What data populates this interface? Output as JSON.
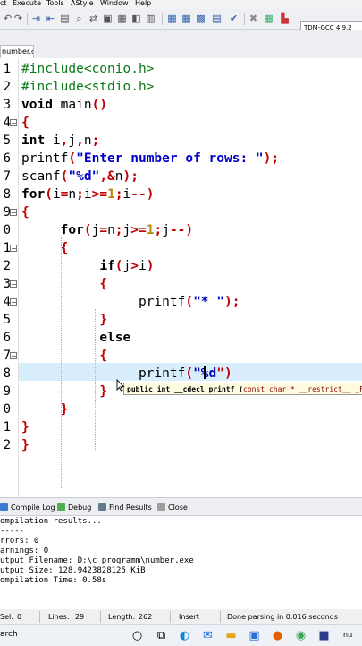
{
  "menu": [
    "ct",
    "Execute",
    "Tools",
    "AStyle",
    "Window",
    "Help"
  ],
  "toolbar": {
    "compiler": "TDM-GCC 4.9.2",
    "icons": [
      "undo-icon",
      "redo-icon",
      "indent-icon",
      "unindent-icon",
      "toggle-comment-icon",
      "search-icon",
      "replace-icon",
      "bookmark-icon",
      "compile-icon",
      "run-icon",
      "compile-run-icon",
      "rebuild-icon",
      "check-icon",
      "stop-icon",
      "debug-icon",
      "profile-icon"
    ]
  },
  "file_tab": "number.c",
  "editor": {
    "gutter_numbers": [
      "1",
      "2",
      "3",
      "4",
      "5",
      "6",
      "7",
      "8",
      "9",
      "0",
      "1",
      "2",
      "3",
      "4",
      "5",
      "6",
      "7",
      "8",
      "9",
      "0",
      "1",
      "2"
    ],
    "fold_lines": [
      3,
      8,
      10,
      12,
      13,
      16
    ],
    "current_line": 17,
    "code_lines": [
      [
        {
          "t": "#include<conio.h>",
          "c": "pp"
        }
      ],
      [
        {
          "t": "#include<stdio.h>",
          "c": "pp"
        }
      ],
      [
        {
          "t": "void",
          "c": "kw"
        },
        {
          "t": " main",
          "c": "fn"
        },
        {
          "t": "()",
          "c": "op"
        }
      ],
      [
        {
          "t": "{",
          "c": "op"
        }
      ],
      [
        {
          "t": "int",
          "c": "kw"
        },
        {
          "t": " i",
          "c": "fn"
        },
        {
          "t": ",",
          "c": "op"
        },
        {
          "t": "j",
          "c": "fn"
        },
        {
          "t": ",",
          "c": "op"
        },
        {
          "t": "n",
          "c": "fn"
        },
        {
          "t": ";",
          "c": "op"
        }
      ],
      [
        {
          "t": "printf",
          "c": "fn"
        },
        {
          "t": "(",
          "c": "op"
        },
        {
          "t": "\"Enter number of rows: \"",
          "c": "str"
        },
        {
          "t": ");",
          "c": "op"
        }
      ],
      [
        {
          "t": "scanf",
          "c": "fn"
        },
        {
          "t": "(",
          "c": "op"
        },
        {
          "t": "\"%d\"",
          "c": "str"
        },
        {
          "t": ",&",
          "c": "op"
        },
        {
          "t": "n",
          "c": "fn"
        },
        {
          "t": ");",
          "c": "op"
        }
      ],
      [
        {
          "t": "for",
          "c": "kw"
        },
        {
          "t": "(",
          "c": "op"
        },
        {
          "t": "i",
          "c": "fn"
        },
        {
          "t": "=",
          "c": "op"
        },
        {
          "t": "n",
          "c": "fn"
        },
        {
          "t": ";",
          "c": "op"
        },
        {
          "t": "i",
          "c": "fn"
        },
        {
          "t": ">=",
          "c": "op"
        },
        {
          "t": "1",
          "c": "num"
        },
        {
          "t": ";",
          "c": "op"
        },
        {
          "t": "i",
          "c": "fn"
        },
        {
          "t": "--)",
          "c": "op"
        }
      ],
      [
        {
          "t": "{",
          "c": "op"
        }
      ],
      [
        {
          "t": "     ",
          "c": "fn"
        },
        {
          "t": "for",
          "c": "kw"
        },
        {
          "t": "(",
          "c": "op"
        },
        {
          "t": "j",
          "c": "fn"
        },
        {
          "t": "=",
          "c": "op"
        },
        {
          "t": "n",
          "c": "fn"
        },
        {
          "t": ";",
          "c": "op"
        },
        {
          "t": "j",
          "c": "fn"
        },
        {
          "t": ">=",
          "c": "op"
        },
        {
          "t": "1",
          "c": "num"
        },
        {
          "t": ";",
          "c": "op"
        },
        {
          "t": "j",
          "c": "fn"
        },
        {
          "t": "--)",
          "c": "op"
        }
      ],
      [
        {
          "t": "     ",
          "c": "fn"
        },
        {
          "t": "{",
          "c": "op"
        }
      ],
      [
        {
          "t": "          ",
          "c": "fn"
        },
        {
          "t": "if",
          "c": "kw"
        },
        {
          "t": "(",
          "c": "op"
        },
        {
          "t": "j",
          "c": "fn"
        },
        {
          "t": ">",
          "c": "op"
        },
        {
          "t": "i",
          "c": "fn"
        },
        {
          "t": ")",
          "c": "op"
        }
      ],
      [
        {
          "t": "          ",
          "c": "fn"
        },
        {
          "t": "{",
          "c": "op"
        }
      ],
      [
        {
          "t": "               ",
          "c": "fn"
        },
        {
          "t": "printf",
          "c": "fn"
        },
        {
          "t": "(",
          "c": "op"
        },
        {
          "t": "\"* \"",
          "c": "str"
        },
        {
          "t": ");",
          "c": "op"
        }
      ],
      [
        {
          "t": "          ",
          "c": "fn"
        },
        {
          "t": "}",
          "c": "op"
        }
      ],
      [
        {
          "t": "          ",
          "c": "fn"
        },
        {
          "t": "else",
          "c": "kw"
        }
      ],
      [
        {
          "t": "          ",
          "c": "fn"
        },
        {
          "t": "{",
          "c": "op"
        }
      ],
      [
        {
          "t": "               ",
          "c": "fn"
        },
        {
          "t": "printf",
          "c": "fn"
        },
        {
          "t": "(",
          "c": "op"
        },
        {
          "t": "\"%d",
          "c": "str"
        },
        {
          "t": "\")",
          "c": "op"
        }
      ],
      [
        {
          "t": "          ",
          "c": "fn"
        },
        {
          "t": "}",
          "c": "op"
        }
      ],
      [
        {
          "t": "     ",
          "c": "fn"
        },
        {
          "t": "}",
          "c": "op"
        }
      ],
      [
        {
          "t": "}",
          "c": "op"
        }
      ],
      [
        {
          "t": "}",
          "c": "op"
        }
      ]
    ],
    "tooltip": {
      "prefix": "public int __cdecl printf (",
      "params": "const char * __restrict__ _F"
    }
  },
  "bottom_tabs": [
    {
      "label": "Compile Log",
      "color": "#3a7bd5"
    },
    {
      "label": "Debug",
      "color": "#4caf50"
    },
    {
      "label": "Find Results",
      "color": "#607d8b"
    },
    {
      "label": "Close",
      "color": "#9e9e9e"
    }
  ],
  "log": [
    "ompilation results...",
    "-----",
    "rrors: 0",
    "arnings: 0",
    "utput Filename: D:\\c programm\\number.exe",
    "utput Size: 128.9423828125 KiB",
    "ompilation Time: 0.58s"
  ],
  "status": {
    "sel_label": "Sel:",
    "sel_value": "0",
    "lines_label": "Lines:",
    "lines_value": "29",
    "length_label": "Length:",
    "length_value": "262",
    "mode": "Insert",
    "message": "Done parsing in 0.016 seconds"
  },
  "taskbar": {
    "search_text": "arch",
    "icons": [
      "search-circle-icon",
      "task-view-icon",
      "edge-icon",
      "mail-icon",
      "file-explorer-icon",
      "store-icon",
      "firefox-icon",
      "chrome-icon",
      "devcpp-icon"
    ],
    "extra": "nu"
  }
}
